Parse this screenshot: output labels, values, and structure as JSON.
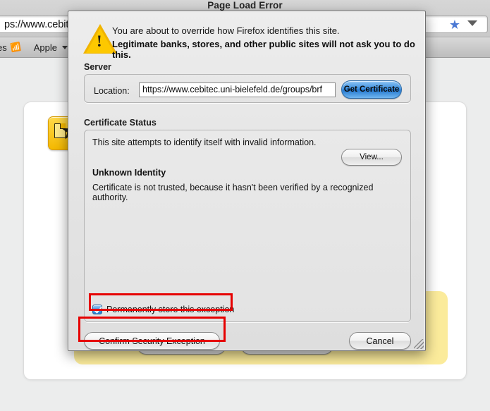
{
  "window": {
    "sheet_title": "Page Load Error"
  },
  "browser": {
    "url_bar": {
      "value": "ps://www.cebitec",
      "full_value": "https://www.cebitec",
      "star_icon": "bookmark-star-icon",
      "chevron_icon": "chevron-down-icon"
    },
    "bookmarks_bar": {
      "items": [
        {
          "label": "es",
          "icon": "rss-icon"
        },
        {
          "label": "Apple",
          "icon": "chevron-down-icon"
        }
      ]
    }
  },
  "page": {
    "warning_icon": "broken-certificate-icon",
    "yellow_panel": {
      "button_left_label": "",
      "button_right_label": ""
    }
  },
  "dialog": {
    "warning_icon": "warning-triangle-icon",
    "header": {
      "line1": "You are about to override how Firefox identifies this site.",
      "line2": "Legitimate banks, stores, and other public sites will not ask you to do this."
    },
    "server": {
      "group_label": "Server",
      "location_label": "Location:",
      "location_value": "https://www.cebitec.uni-bielefeld.de/groups/brf",
      "location_placeholder": "https://",
      "get_certificate_label": "Get Certificate"
    },
    "certificate_status": {
      "group_label": "Certificate Status",
      "summary": "This site attempts to identify itself with invalid information.",
      "view_label": "View...",
      "identity_heading": "Unknown Identity",
      "identity_detail": "Certificate is not trusted, because it hasn't been verified by a recognized authority."
    },
    "permanent_checkbox": {
      "label": "Permanently store this exception",
      "checked": true
    },
    "buttons": {
      "confirm_label": "Confirm Security Exception",
      "cancel_label": "Cancel"
    },
    "resize_grip_icon": "resize-grip-icon"
  },
  "annotations": {
    "highlight_color": "#e60000",
    "highlighted": [
      "Permanently store this exception",
      "Confirm Security Exception"
    ]
  }
}
